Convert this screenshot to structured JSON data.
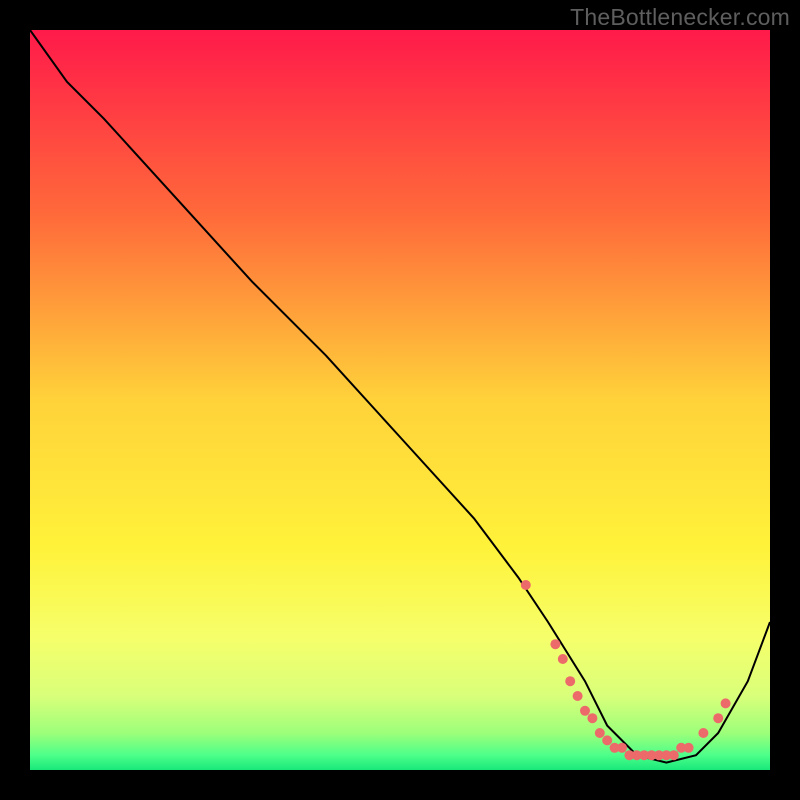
{
  "watermark": "TheBottlenecker.com",
  "chart_data": {
    "type": "line",
    "title": "",
    "xlabel": "",
    "ylabel": "",
    "xlim": [
      0,
      100
    ],
    "ylim": [
      0,
      100
    ],
    "series": [
      {
        "name": "bottleneck-curve",
        "x": [
          0,
          5,
          10,
          20,
          30,
          40,
          50,
          60,
          66,
          70,
          75,
          78,
          82,
          86,
          90,
          93,
          97,
          100
        ],
        "y": [
          100,
          93,
          88,
          77,
          66,
          56,
          45,
          34,
          26,
          20,
          12,
          6,
          2,
          1,
          2,
          5,
          12,
          20
        ]
      }
    ],
    "marker_points": {
      "name": "optimal-range-markers",
      "color": "#ed6a6a",
      "x": [
        67,
        71,
        72,
        73,
        74,
        75,
        76,
        77,
        78,
        79,
        80,
        81,
        82,
        83,
        84,
        85,
        86,
        87,
        88,
        89,
        91,
        93,
        94
      ],
      "y": [
        25,
        17,
        15,
        12,
        10,
        8,
        7,
        5,
        4,
        3,
        3,
        2,
        2,
        2,
        2,
        2,
        2,
        2,
        3,
        3,
        5,
        7,
        9
      ]
    },
    "background_gradient": {
      "stops": [
        {
          "pos": 0.0,
          "color": "#ff1a4a"
        },
        {
          "pos": 0.25,
          "color": "#ff6a3a"
        },
        {
          "pos": 0.5,
          "color": "#ffd23a"
        },
        {
          "pos": 0.7,
          "color": "#fff23a"
        },
        {
          "pos": 0.82,
          "color": "#f6ff6a"
        },
        {
          "pos": 0.9,
          "color": "#d9ff7a"
        },
        {
          "pos": 0.95,
          "color": "#9dff7a"
        },
        {
          "pos": 0.98,
          "color": "#4dff8a"
        },
        {
          "pos": 1.0,
          "color": "#18e87a"
        }
      ]
    }
  }
}
